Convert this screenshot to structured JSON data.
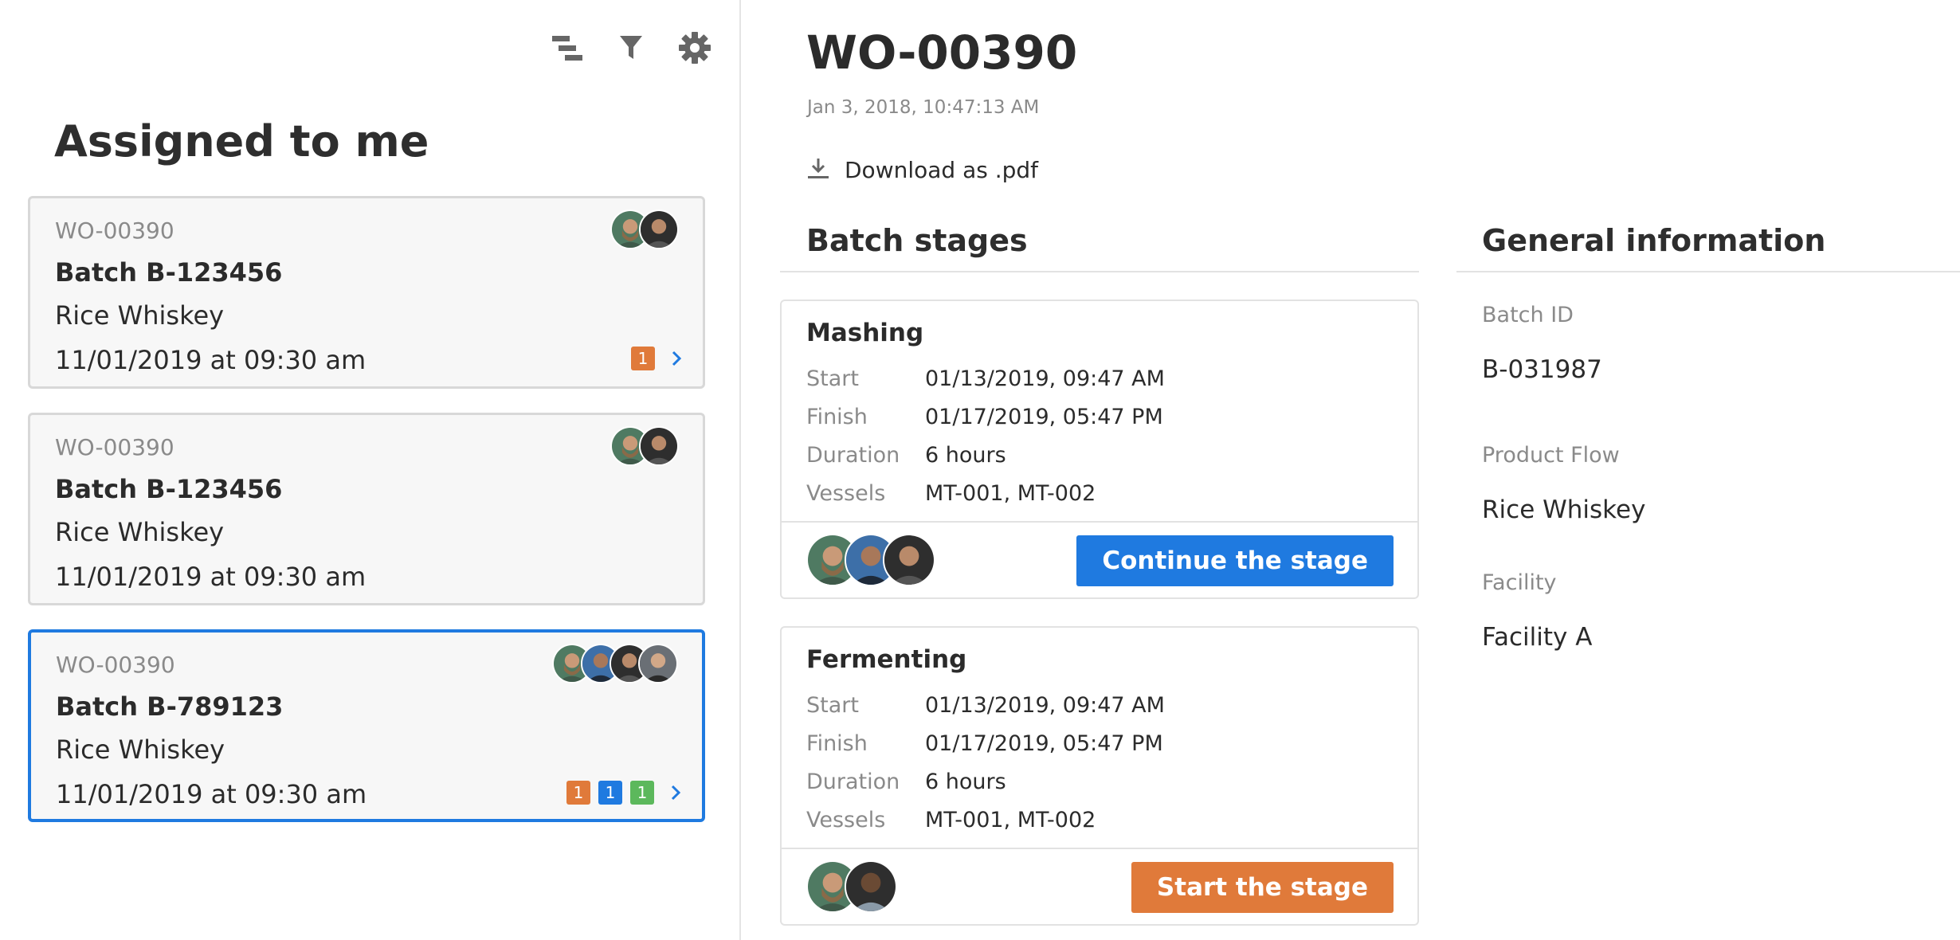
{
  "toolbar": {
    "icons": [
      "gantt-icon",
      "filter-icon",
      "gear-icon"
    ]
  },
  "left": {
    "title": "Assigned to me",
    "cards": [
      {
        "wo": "WO-00390",
        "batch": "Batch B-123456",
        "product": "Rice Whiskey",
        "date": "11/01/2019 at 09:30 am",
        "avatars": [
          "avatar-bearded",
          "avatar-dark"
        ],
        "badges": [
          {
            "value": "1",
            "color": "#e07a3a"
          }
        ],
        "selected": false
      },
      {
        "wo": "WO-00390",
        "batch": "Batch B-123456",
        "product": "Rice Whiskey",
        "date": "11/01/2019 at 09:30 am",
        "avatars": [
          "avatar-bearded",
          "avatar-dark"
        ],
        "badges": [],
        "selected": false
      },
      {
        "wo": "WO-00390",
        "batch": "Batch B-789123",
        "product": "Rice Whiskey",
        "date": "11/01/2019 at 09:30 am",
        "avatars": [
          "avatar-bearded",
          "avatar-blue",
          "avatar-dark",
          "avatar-grey"
        ],
        "badges": [
          {
            "value": "1",
            "color": "#e07a3a"
          },
          {
            "value": "1",
            "color": "#1f7ae0"
          },
          {
            "value": "1",
            "color": "#5cb85c"
          }
        ],
        "selected": true
      }
    ]
  },
  "detail": {
    "title": "WO-00390",
    "timestamp": "Jan 3, 2018, 10:47:13 AM",
    "download_label": "Download as .pdf",
    "stages_heading": "Batch stages",
    "stages": [
      {
        "name": "Mashing",
        "rows": [
          {
            "label": "Start",
            "value": "01/13/2019, 09:47 AM"
          },
          {
            "label": "Finish",
            "value": "01/17/2019, 05:47 PM"
          },
          {
            "label": "Duration",
            "value": "6 hours"
          },
          {
            "label": "Vessels",
            "value": "MT-001, MT-002"
          }
        ],
        "avatars": [
          "avatar-bearded",
          "avatar-blue",
          "avatar-dark"
        ],
        "button": "Continue the stage",
        "button_color": "#1f7ae0"
      },
      {
        "name": "Fermenting",
        "rows": [
          {
            "label": "Start",
            "value": "01/13/2019, 09:47 AM"
          },
          {
            "label": "Finish",
            "value": "01/17/2019, 05:47 PM"
          },
          {
            "label": "Duration",
            "value": "6 hours"
          },
          {
            "label": "Vessels",
            "value": "MT-001, MT-002"
          }
        ],
        "avatars": [
          "avatar-bearded",
          "avatar-dark"
        ],
        "button": "Start the stage",
        "button_color": "#e07a3a"
      }
    ],
    "info_heading": "General information",
    "info": [
      {
        "label": "Batch ID",
        "value": "B-031987"
      },
      {
        "label": "Product Flow",
        "value": "Rice Whiskey"
      },
      {
        "label": "Facility",
        "value": "Facility A"
      }
    ]
  },
  "colors": {
    "accent": "#1f7ae0",
    "warning": "#e07a3a",
    "success": "#5cb85c"
  }
}
